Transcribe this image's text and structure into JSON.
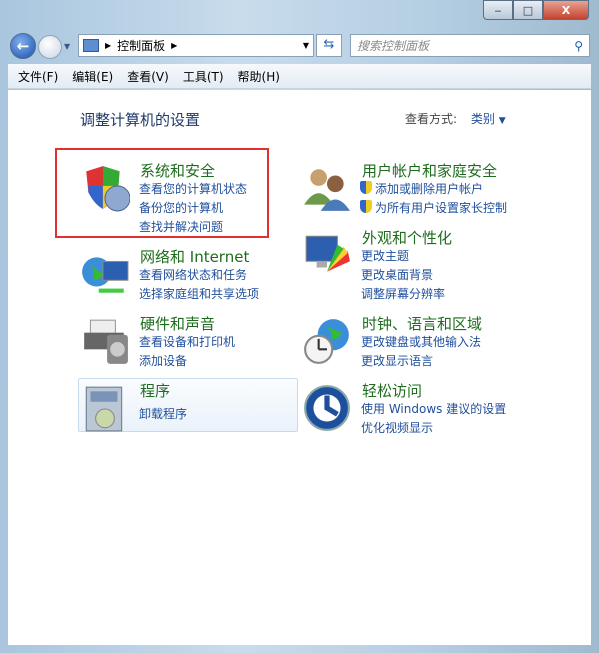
{
  "window": {
    "minimize": "‒",
    "maximize": "□",
    "close": "X"
  },
  "nav": {
    "breadcrumb": "控制面板",
    "search_placeholder": "搜索控制面板"
  },
  "menu": [
    "文件(F)",
    "编辑(E)",
    "查看(V)",
    "工具(T)",
    "帮助(H)"
  ],
  "header": {
    "title": "调整计算机的设置",
    "view_label": "查看方式:",
    "view_value": "类别"
  },
  "categories": [
    {
      "title": "系统和安全",
      "icon": "shield-icon",
      "links": [
        "查看您的计算机状态",
        "备份您的计算机",
        "查找并解决问题"
      ]
    },
    {
      "title": "网络和 Internet",
      "icon": "network-icon",
      "links": [
        "查看网络状态和任务",
        "选择家庭组和共享选项"
      ]
    },
    {
      "title": "硬件和声音",
      "icon": "printer-icon",
      "links": [
        "查看设备和打印机",
        "添加设备"
      ]
    },
    {
      "title": "程序",
      "icon": "programs-icon",
      "links": [
        "卸载程序"
      ]
    },
    {
      "title": "用户帐户和家庭安全",
      "icon": "users-icon",
      "links": [
        "添加或删除用户帐户",
        "为所有用户设置家长控制"
      ]
    },
    {
      "title": "外观和个性化",
      "icon": "appearance-icon",
      "links": [
        "更改主题",
        "更改桌面背景",
        "调整屏幕分辨率"
      ]
    },
    {
      "title": "时钟、语言和区域",
      "icon": "clock-globe-icon",
      "links": [
        "更改键盘或其他输入法",
        "更改显示语言"
      ]
    },
    {
      "title": "轻松访问",
      "icon": "ease-of-access-icon",
      "links": [
        "使用 Windows 建议的设置",
        "优化视频显示"
      ]
    }
  ],
  "colors": {
    "title": "#1e6d1e",
    "link": "#1f4f9c",
    "highlight": "#e03030"
  }
}
